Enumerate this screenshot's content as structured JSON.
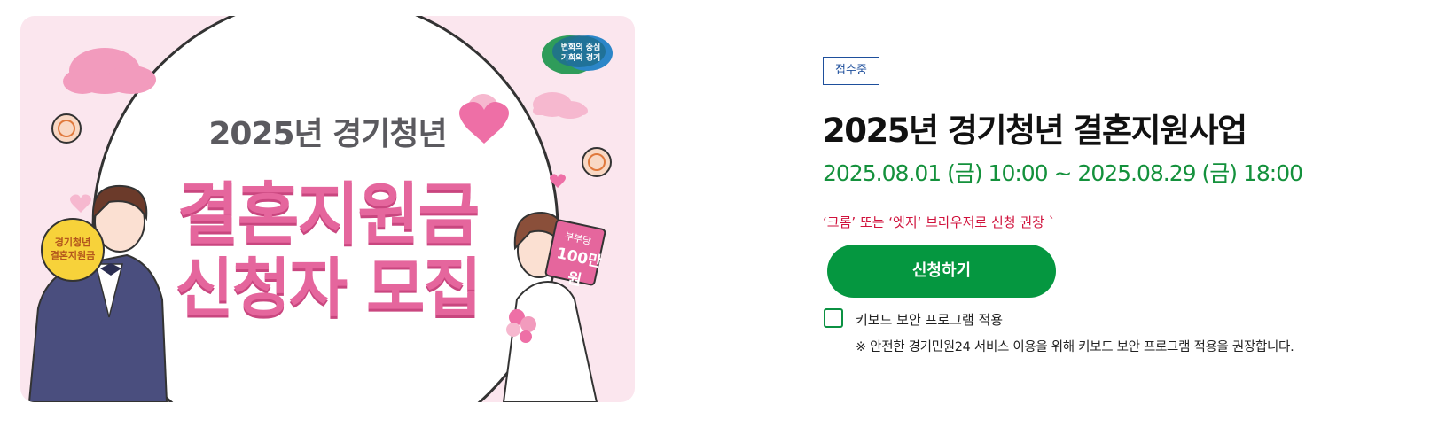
{
  "banner": {
    "logo_line1": "변화의 중심",
    "logo_line2": "기회의 경기",
    "year_line": "2025년 경기청년",
    "title_line1": "결혼지원금",
    "title_line2": "신청자 모집",
    "groom_sign_line1": "경기청년",
    "groom_sign_line2": "결혼지원금",
    "bride_card_label": "부부당",
    "bride_card_amount": "100만원",
    "colors": {
      "background": "#fbe6ee",
      "title_pink": "#e5669d",
      "year_gray": "#5b5a5f"
    }
  },
  "detail": {
    "status_badge": "접수중",
    "title": "2025년 경기청년 결혼지원사업",
    "period": "2025.08.01 (금) 10:00 ~ 2025.08.29 (금) 18:00",
    "browser_notice": "‘크롬’ 또는 ‘엣지‘ 브라우저로 신청 권장 `",
    "apply_button": "신청하기",
    "keyboard_security_label": "키보드 보안 프로그램 적용",
    "keyboard_security_note": "※ 안전한 경기민원24 서비스 이용을 위해 키보드 보안 프로그램 적용을 권장합니다.",
    "keyboard_security_checked": false,
    "colors": {
      "badge_blue": "#1e4f9c",
      "period_green": "#14913c",
      "notice_red": "#d0123c",
      "button_green": "#059740"
    }
  }
}
